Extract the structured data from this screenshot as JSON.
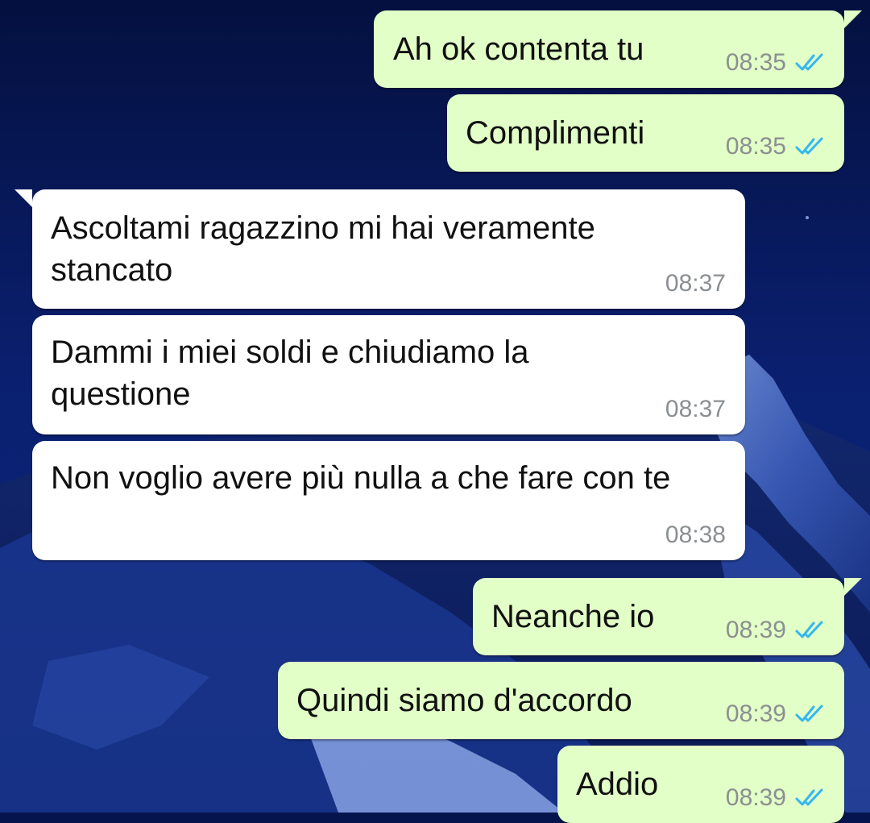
{
  "colors": {
    "outgoing_bubble": "#e2ffc7",
    "incoming_bubble": "#ffffff",
    "read_ticks": "#34b7f1",
    "timestamp": "#8b8f92"
  },
  "messages": [
    {
      "direction": "outgoing",
      "text": "Ah ok contenta tu",
      "time": "08:35",
      "status": "read"
    },
    {
      "direction": "outgoing",
      "text": "Complimenti",
      "time": "08:35",
      "status": "read"
    },
    {
      "direction": "incoming",
      "text": "Ascoltami ragazzino mi hai veramente\nstancato",
      "time": "08:37"
    },
    {
      "direction": "incoming",
      "text": "Dammi i miei soldi e chiudiamo la\nquestione",
      "time": "08:37"
    },
    {
      "direction": "incoming",
      "text": "Non voglio avere più nulla a che fare con te",
      "time": "08:38"
    },
    {
      "direction": "outgoing",
      "text": "Neanche io",
      "time": "08:39",
      "status": "read"
    },
    {
      "direction": "outgoing",
      "text": "Quindi siamo d'accordo",
      "time": "08:39",
      "status": "read"
    },
    {
      "direction": "outgoing",
      "text": "Addio",
      "time": "08:39",
      "status": "read"
    }
  ]
}
